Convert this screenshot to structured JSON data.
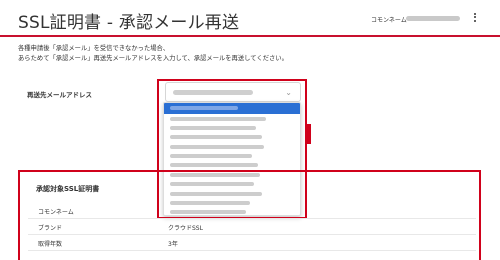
{
  "header": {
    "title": "SSL証明書 - 承認メール再送",
    "common_name_label": "コモンネーム"
  },
  "description": {
    "line1": "各種申請後「承認メール」を受信できなかった場合、",
    "line2": "あらためて「承認メール」再送先メールアドレスを入力して、承認メールを再送してください。"
  },
  "form": {
    "address_label": "再送先メールアドレス",
    "chevron_icon": "chevron-down-icon",
    "option_count": 12
  },
  "certificate": {
    "title": "承認対象SSL証明書",
    "rows": [
      {
        "key": "コモンネーム",
        "value": ""
      },
      {
        "key": "ブランド",
        "value": "クラウドSSL"
      },
      {
        "key": "取得年数",
        "value": "3年"
      }
    ]
  },
  "colors": {
    "accent_red": "#d0011b",
    "selected_blue": "#2a6fd4"
  }
}
